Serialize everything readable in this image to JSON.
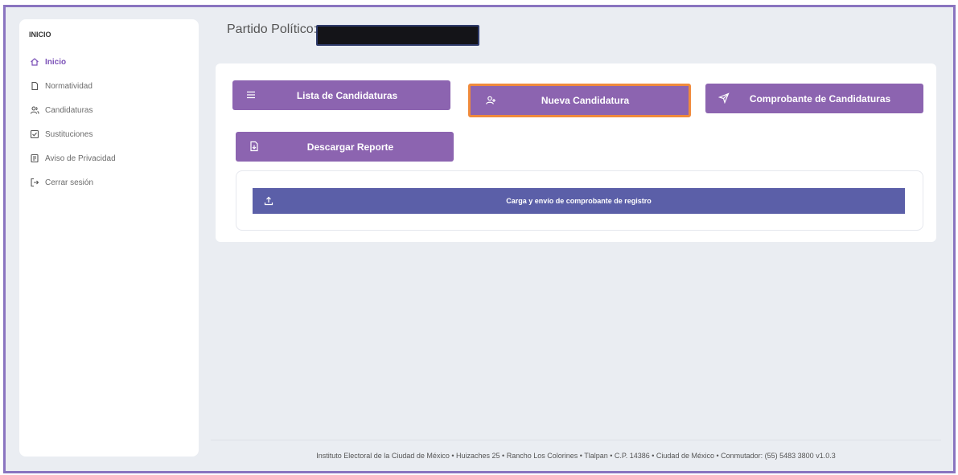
{
  "sidebar": {
    "heading": "INICIO",
    "items": [
      {
        "label": "Inicio",
        "icon": "home-icon",
        "active": true
      },
      {
        "label": "Normatividad",
        "icon": "document-icon",
        "active": false
      },
      {
        "label": "Candidaturas",
        "icon": "users-icon",
        "active": false
      },
      {
        "label": "Sustituciones",
        "icon": "checkbox-icon",
        "active": false
      },
      {
        "label": "Aviso de Privacidad",
        "icon": "book-icon",
        "active": false
      },
      {
        "label": "Cerrar sesión",
        "icon": "logout-icon",
        "active": false
      }
    ]
  },
  "header": {
    "party_label": "Partido Político:"
  },
  "actions": {
    "lista": "Lista de Candidaturas",
    "nueva": "Nueva Candidatura",
    "comprobante": "Comprobante de Candidaturas",
    "reporte": "Descargar Reporte"
  },
  "upload": {
    "label": "Carga y envío de comprobante de registro"
  },
  "footer": {
    "text": "Instituto Electoral de la Ciudad de México • Huizaches 25 • Rancho Los Colorines • Tlalpan • C.P. 14386 • Ciudad de México • Conmutador: (55) 5483 3800 v1.0.3"
  },
  "colors": {
    "accent": "#8c64b0",
    "highlight_border": "#f08a3c",
    "upload_bar": "#5b5fa8",
    "frame": "#8a74c0"
  }
}
